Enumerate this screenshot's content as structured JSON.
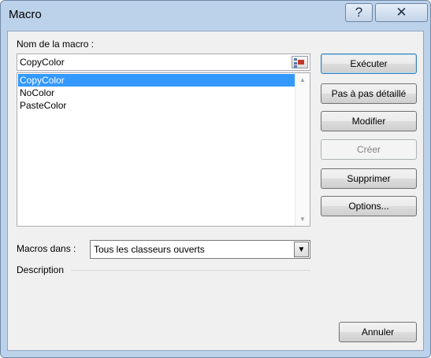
{
  "window": {
    "title": "Macro",
    "help_glyph": "?",
    "close_glyph": "✕"
  },
  "macro_name": {
    "label": "Nom de la macro :",
    "value": "CopyColor"
  },
  "macro_list": {
    "items": [
      "CopyColor",
      "NoColor",
      "PasteColor"
    ],
    "selected_index": 0
  },
  "macros_in": {
    "label": "Macros dans :",
    "selected": "Tous les classeurs ouverts"
  },
  "description": {
    "label": "Description"
  },
  "buttons": {
    "run": "Exécuter",
    "step": "Pas à pas détaillé",
    "edit": "Modifier",
    "create": "Créer",
    "delete": "Supprimer",
    "options": "Options...",
    "cancel": "Annuler"
  },
  "colors": {
    "selection": "#3399ff",
    "frame": "#bcd2ea"
  }
}
